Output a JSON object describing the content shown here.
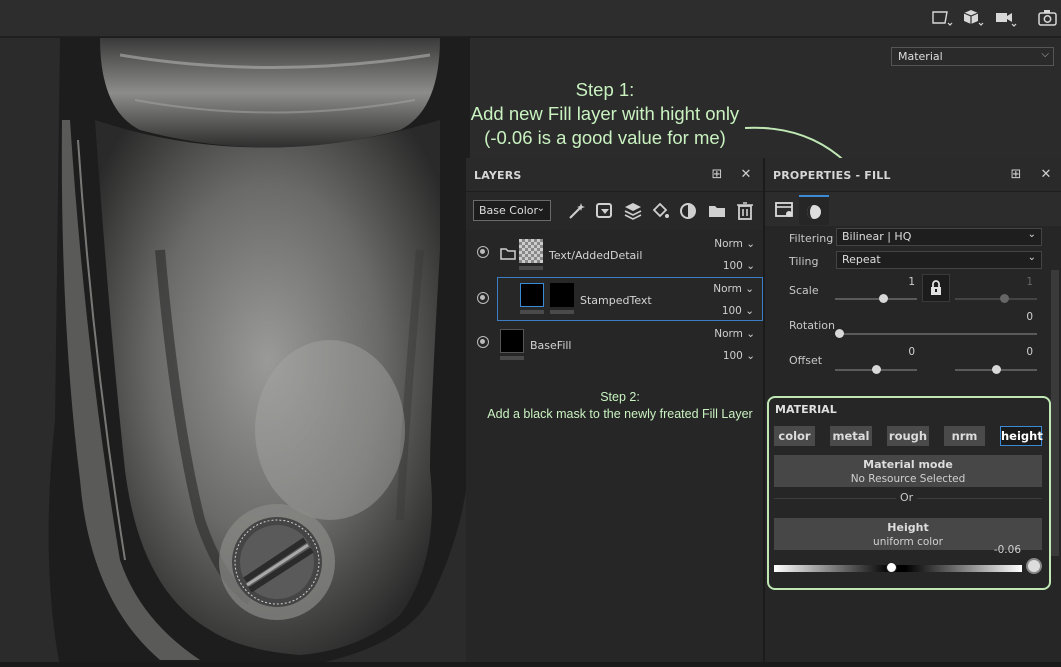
{
  "toolbar": {
    "icons": [
      "camera-path-icon",
      "cube-icon",
      "video-camera-icon",
      "screenshot-camera-icon"
    ]
  },
  "viewport": {
    "material_select": "Material",
    "annotations": {
      "step1": [
        "Step 1:",
        "Add new Fill layer with hight only",
        "(-0.06 is a good value for me)"
      ],
      "step2": [
        "Step 2:",
        "Add a black mask to the newly freated Fill Layer"
      ]
    }
  },
  "layers": {
    "title": "LAYERS",
    "blend_mode": "Base Color",
    "rows": [
      {
        "name": "Text/AddedDetail",
        "blend": "Norm",
        "opacity": "100",
        "type": "folder"
      },
      {
        "name": "StampedText",
        "blend": "Norm",
        "opacity": "100",
        "type": "fill-with-mask"
      },
      {
        "name": "BaseFill",
        "blend": "Norm",
        "opacity": "100",
        "type": "fill"
      }
    ]
  },
  "properties": {
    "title": "PROPERTIES - FILL",
    "filtering_label": "Filtering",
    "filtering_value": "Bilinear | HQ",
    "tiling_label": "Tiling",
    "tiling_value": "Repeat",
    "scale_label": "Scale",
    "scale_values": [
      "1",
      "1"
    ],
    "scale_levels": [
      0.5,
      0.5
    ],
    "rotation_label": "Rotation",
    "rotation_value": "0",
    "offset_label": "Offset",
    "offset_values": [
      "0",
      "0"
    ],
    "material": {
      "title": "MATERIAL",
      "channels": [
        "color",
        "metal",
        "rough",
        "nrm",
        "height"
      ],
      "active_channel": "height",
      "mode_title": "Material mode",
      "mode_sub": "No Resource Selected",
      "or_text": "Or",
      "height_title": "Height",
      "height_sub": "uniform color",
      "height_value": "-0.06"
    }
  },
  "colors": {
    "accent": "#3b8ad6",
    "annotation": "#c9f2c0"
  }
}
